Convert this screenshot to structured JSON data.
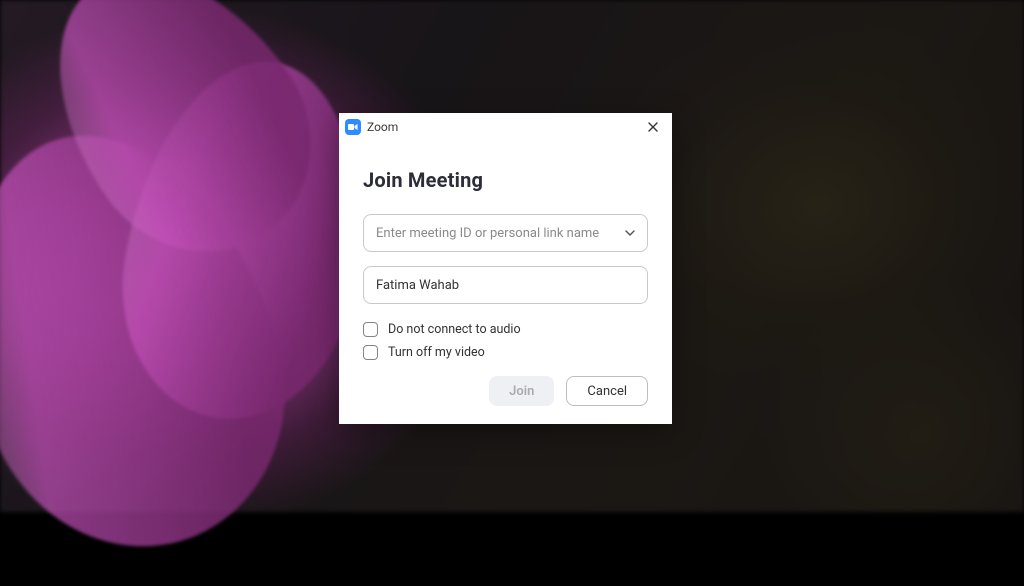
{
  "app": {
    "name": "Zoom",
    "icon": "zoom-video-icon"
  },
  "dialog": {
    "title": "Join Meeting",
    "meeting_id": {
      "value": "",
      "placeholder": "Enter meeting ID or personal link name"
    },
    "display_name": {
      "value": "Fatima Wahab"
    },
    "options": {
      "no_audio": {
        "label": "Do not connect to audio",
        "checked": false
      },
      "no_video": {
        "label": "Turn off my video",
        "checked": false
      }
    },
    "buttons": {
      "join": "Join",
      "cancel": "Cancel"
    }
  },
  "colors": {
    "zoom_blue": "#2d8cff"
  }
}
